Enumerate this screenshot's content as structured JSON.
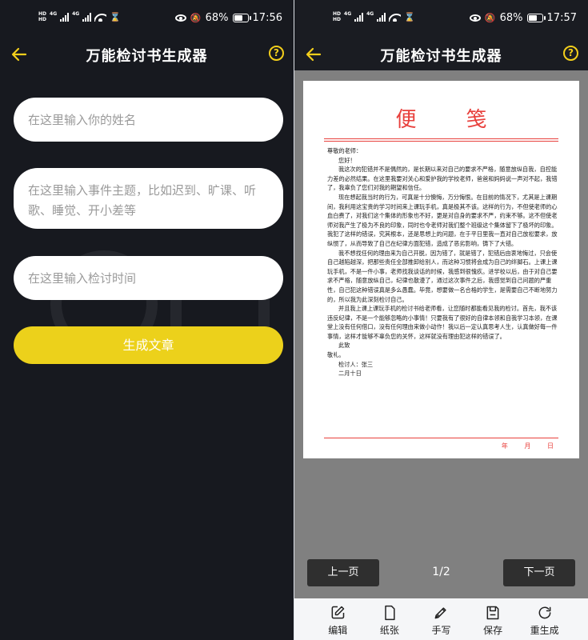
{
  "status_left": {
    "time": "17:56",
    "battery": "68%",
    "battery_level": 0.68
  },
  "status_right": {
    "time": "17:57",
    "battery": "68%",
    "battery_level": 0.68
  },
  "app": {
    "title": "万能检讨书生成器",
    "help": "?"
  },
  "form": {
    "name_placeholder": "在这里输入你的姓名",
    "topic_placeholder": "在这里输入事件主题，比如迟到、旷课、听歌、睡觉、开小差等",
    "time_placeholder": "在这里输入检讨时间",
    "generate_label": "生成文章"
  },
  "paper": {
    "header": "便笺",
    "salutation": "尊敬的老师：",
    "greeting": "您好！",
    "paragraphs": [
      "我这次的犯错并不是偶然的，是长期以来对自己的要求不严格，随意放纵自我，自控能力差的必然结果。在这里我要对关心和爱护我的学校老师，爸爸和妈妈说一声对不起，我错了，我辜负了您们对我的期望和信任。",
      "现在想起我当时的行为，可真是十分懊悔，万分悔恨。在目前的情况下，尤其是上课期间，我利用这宝贵的学习时间来上课玩手机，真是极其不该。这样的行为，不但使老师的心血白费了，对我们这个集体的形象也不好，更是对自身的要求不严，约束不够。这不但使老师对我产生了极为不良的印象，同时也令老师对我们整个班级这个集体留下了极坏的印象。我犯了这样的错误，究其根本，还是思想上的问题，在于平日里我一直对自己放松要求，放纵惯了，从而导致了自己在纪律方面犯错，造成了恶劣影响，铸下了大错。",
      "我不想找任何的理由来为自己开脱，因为错了，就是错了，犯错后由衷地悔过，只会使自己越陷越深，把那些责任全部推卸给别人，而这种习惯将会成为自己的绊脚石。上课上课玩手机，不是一件小事，老师找我谈话的时候，我感到很愧疚。进学校以后，由于对自己要求不严格，随意放纵自己，纪律也散漫了，通过这次事件之后，我感觉到自己问题的严重性，自己犯这种错误真是多么愚蠢。毕竟，想要做一名合格的学生，是需要自己不断地努力的，所以我为此深刻检讨自己。",
      "并且我上课上课玩手机的检讨书给老师看，让您随时都能看见我的检讨。首先，我不该违反纪律，不是一个能够忽略的小事情！只要我有了很好的自律本领和自我学习本领，在课堂上没有任何借口，没有任何理由来做小动作！我以后一定认真思考人生，认真做好每一件事情，这样才能够不辜负您的关怀，这样就没有理由犯这样的错误了。"
    ],
    "closing_1": "此致",
    "closing_2": "敬礼。",
    "signer": "检讨人：张三",
    "sign_date": "二月十日",
    "date_labels": [
      "年",
      "月",
      "日"
    ]
  },
  "pager": {
    "prev": "上一页",
    "next": "下一页",
    "page": "1/2"
  },
  "toolbar": {
    "edit": "编辑",
    "paper": "纸张",
    "handwrite": "手写",
    "save": "保存",
    "regenerate": "重生成"
  },
  "colors": {
    "accent": "#ecd11b",
    "dark_bg": "#17191f",
    "paper_red": "#e8403c",
    "preview_gray": "#808080"
  }
}
